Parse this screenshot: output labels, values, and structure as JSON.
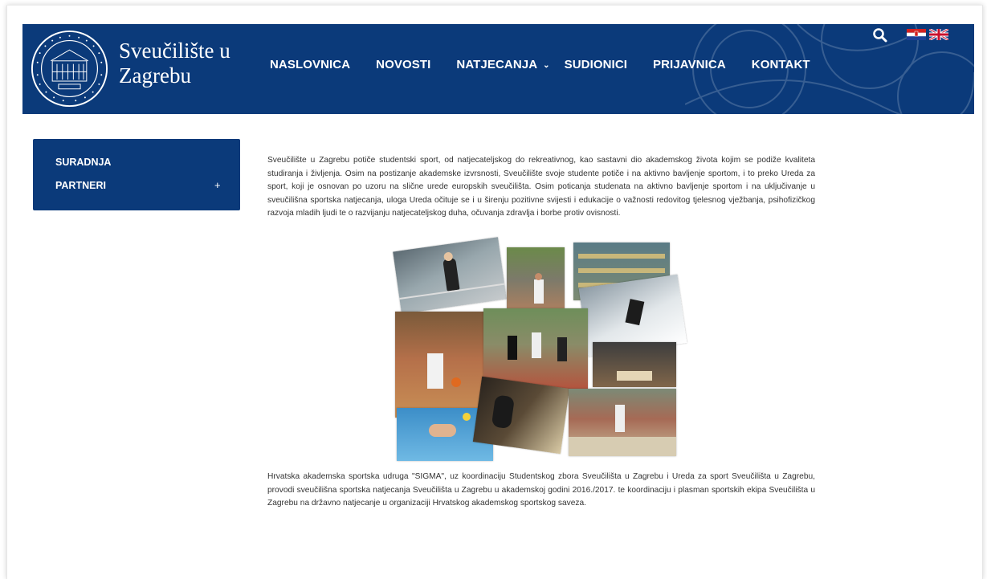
{
  "header": {
    "brand_line1": "Sveučilište u",
    "brand_line2": "Zagrebu",
    "nav": [
      {
        "label": "NASLOVNICA"
      },
      {
        "label": "NOVOSTI"
      },
      {
        "label": "NATJECANJA"
      },
      {
        "label": "SUDIONICI"
      },
      {
        "label": "PRIJAVNICA"
      },
      {
        "label": "KONTAKT"
      }
    ],
    "search_icon": "search-icon",
    "languages": [
      "Croatian flag",
      "UK flag"
    ]
  },
  "sidebar": {
    "items": [
      {
        "label": "SURADNJA"
      },
      {
        "label": "PARTNERI",
        "expand": "+"
      }
    ]
  },
  "content": {
    "paragraph1": "Sveučilište u Zagrebu potiče studentski sport, od natjecateljskog do rekreativnog, kao sastavni dio akademskog života kojim se podiže kvaliteta studiranja i življenja. Osim na postizanje akademske izvrsnosti, Sveučilište svoje studente potiče i na aktivno bavljenje sportom, i to preko Ureda za sport, koji je osnovan po uzoru na slične urede europskih sveučilišta. Osim poticanja studenata na aktivno bavljenje sportom i na uključivanje u sveučilišna sportska natjecanja, uloga Ureda očituje se i u širenju pozitivne svijesti i edukacije o važnosti redovitog tjelesnog vježbanja, psihofizičkog razvoja mladih ljudi te o razvijanju natjecateljskog duha, očuvanja zdravlja i borbe protiv ovisnosti.",
    "paragraph2": "Hrvatska akademska sportska udruga \"SIGMA\", uz koordinaciju Studentskog zbora Sveučilišta u Zagrebu i Ureda za sport Sveučilišta u Zagrebu, provodi sveučilišna sportska natjecanja Sveučilišta u Zagrebu u akademskoj godini 2016./2017. te koordinaciju i plasman sportskih ekipa Sveučilišta u Zagrebu na državno natjecanje u organizaciji Hrvatskog akademskog sportskog saveza."
  },
  "colors": {
    "brand_blue": "#0b3a7a",
    "text": "#333333"
  }
}
